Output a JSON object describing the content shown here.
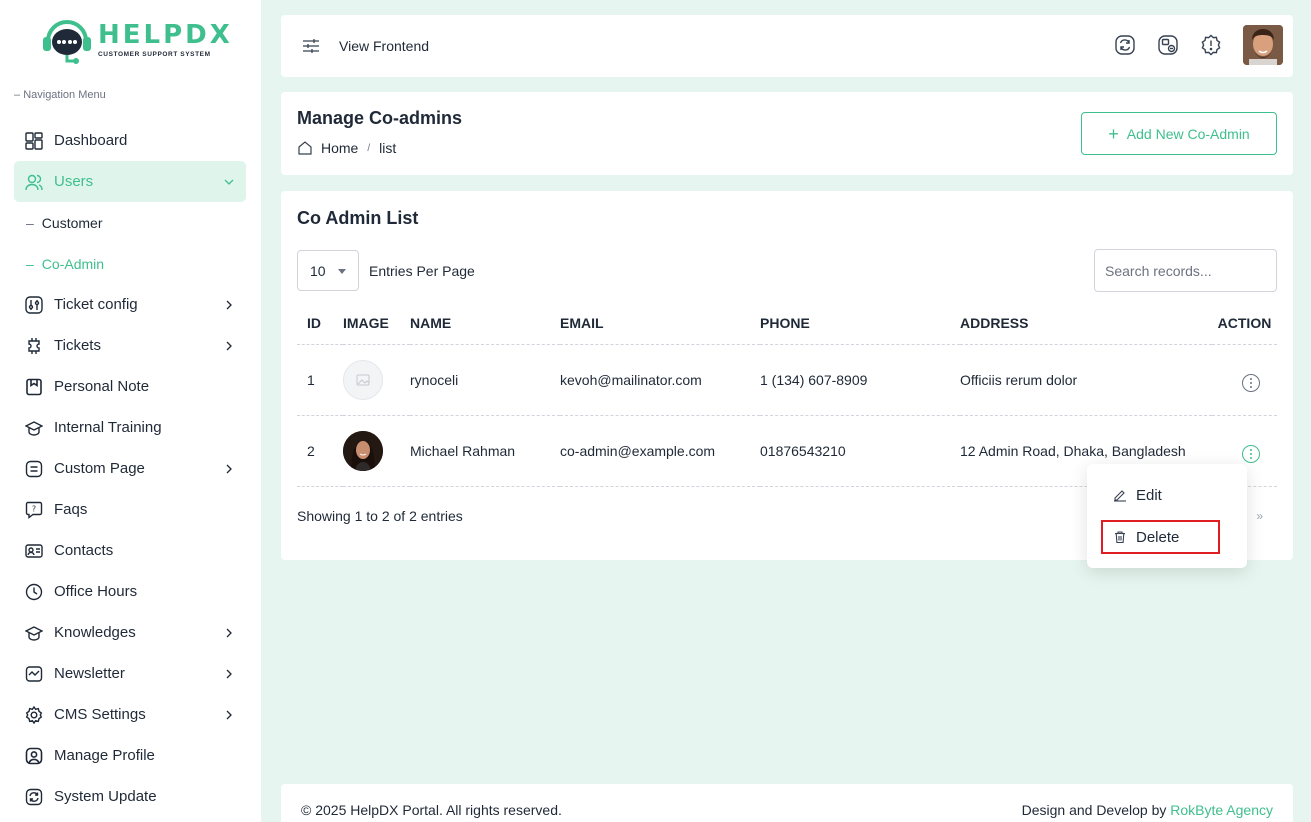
{
  "app": {
    "logo_title": "HELPDX",
    "logo_subtitle": "CUSTOMER SUPPORT SYSTEM",
    "accent_color": "#3fbf8d",
    "danger_color": "#e11d24"
  },
  "sidebar": {
    "heading": "Navigation Menu",
    "items": [
      {
        "label": "Dashboard",
        "icon": "dashboard-icon"
      },
      {
        "label": "Users",
        "icon": "users-icon",
        "expanded": true
      },
      {
        "label": "Customer"
      },
      {
        "label": "Co-Admin",
        "active": true
      },
      {
        "label": "Ticket config",
        "icon": "ticket-config-icon"
      },
      {
        "label": "Tickets",
        "icon": "tickets-icon"
      },
      {
        "label": "Personal Note",
        "icon": "note-icon"
      },
      {
        "label": "Internal Training",
        "icon": "training-icon"
      },
      {
        "label": "Custom Page",
        "icon": "page-icon"
      },
      {
        "label": "Faqs",
        "icon": "faq-icon"
      },
      {
        "label": "Contacts",
        "icon": "contacts-icon"
      },
      {
        "label": "Office Hours",
        "icon": "clock-icon"
      },
      {
        "label": "Knowledges",
        "icon": "knowledge-icon"
      },
      {
        "label": "Newsletter",
        "icon": "newsletter-icon"
      },
      {
        "label": "CMS Settings",
        "icon": "settings-icon"
      },
      {
        "label": "Manage Profile",
        "icon": "profile-icon"
      },
      {
        "label": "System Update",
        "icon": "update-icon"
      }
    ]
  },
  "topbar": {
    "view_frontend": "View Frontend"
  },
  "page": {
    "title": "Manage Co-admins",
    "breadcrumb": {
      "home": "Home",
      "sep": "/",
      "current": "list"
    },
    "add_button": "Add New Co-Admin"
  },
  "list": {
    "title": "Co Admin List",
    "entries_value": "10",
    "entries_label": "Entries Per Page",
    "search_placeholder": "Search records...",
    "columns": [
      "ID",
      "IMAGE",
      "NAME",
      "EMAIL",
      "PHONE",
      "ADDRESS",
      "ACTION"
    ],
    "rows": [
      {
        "id": "1",
        "name": "rynoceli",
        "email": "kevoh@mailinator.com",
        "phone": "1 (134) 607-8909",
        "address": "Officiis rerum dolor"
      },
      {
        "id": "2",
        "name": "Michael Rahman",
        "email": "co-admin@example.com",
        "phone": "01876543210",
        "address": "12 Admin Road, Dhaka, Bangladesh"
      }
    ],
    "showing": "Showing 1 to 2 of 2 entries",
    "next": "»"
  },
  "dropdown": {
    "edit": "Edit",
    "delete": "Delete"
  },
  "footer": {
    "copyright": "© 2025 HelpDX Portal. All rights reserved.",
    "credit_prefix": "Design and Develop by ",
    "credit_link": "RokByte Agency"
  }
}
